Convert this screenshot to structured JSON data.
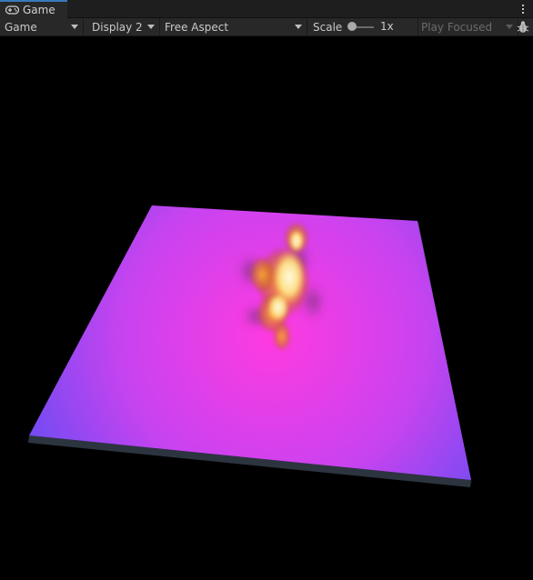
{
  "tab": {
    "title": "Game",
    "icon": "gamepad-icon"
  },
  "toolbar": {
    "view_mode": "Game",
    "display": "Display 2",
    "aspect": "Free Aspect",
    "scale_label": "Scale",
    "scale_value": "1x",
    "play_mode": "Play Focused"
  },
  "icons": {
    "more": "vertical-ellipsis-icon",
    "debug": "bug-icon"
  },
  "colors": {
    "accent_tab": "#3a79bb",
    "toolbar_bg": "#282828",
    "plane_center": "#ff3ae0",
    "plane_edge": "#7a48f0",
    "fire_core": "#fff6c8",
    "fire_outer": "#e89020"
  }
}
